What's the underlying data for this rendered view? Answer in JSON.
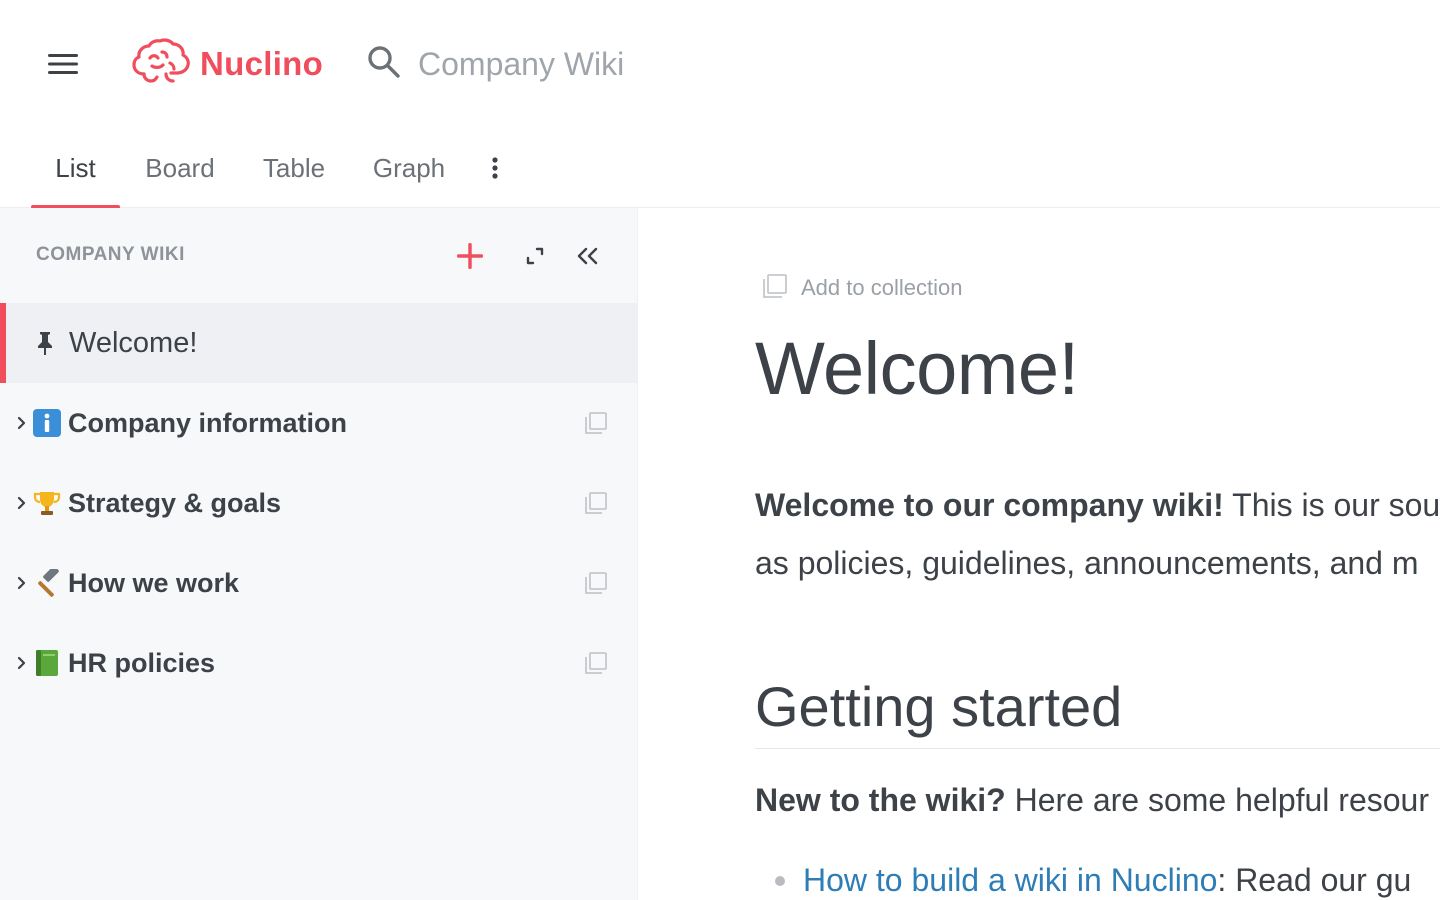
{
  "app": {
    "brand": "Nuclino",
    "accent_color": "#f04d5d"
  },
  "header": {
    "search_placeholder": "Company Wiki",
    "menu_icon": "hamburger-menu-icon",
    "search_icon": "search-icon"
  },
  "tabs": [
    {
      "label": "List",
      "active": true
    },
    {
      "label": "Board",
      "active": false
    },
    {
      "label": "Table",
      "active": false
    },
    {
      "label": "Graph",
      "active": false
    }
  ],
  "sidebar": {
    "title": "COMPANY WIKI",
    "items": [
      {
        "label": "Welcome!",
        "icon": "pin-icon",
        "active": true
      },
      {
        "label": "Company information",
        "icon": "info-icon"
      },
      {
        "label": "Strategy & goals",
        "icon": "trophy-icon"
      },
      {
        "label": "How we work",
        "icon": "hammer-icon"
      },
      {
        "label": "HR policies",
        "icon": "green-book-icon"
      }
    ]
  },
  "document": {
    "add_to_collection": "Add to collection",
    "title": "Welcome!",
    "intro_bold": "Welcome to our company wiki!",
    "intro_rest_line1": " This is our sou",
    "intro_line2": "as policies, guidelines, announcements, and m",
    "heading_getting_started": "Getting started",
    "new_bold": "New to the wiki?",
    "new_rest": " Here are some helpful resour",
    "bullet_link": "How to build a wiki in Nuclino",
    "bullet_rest": ": Read our gu"
  }
}
